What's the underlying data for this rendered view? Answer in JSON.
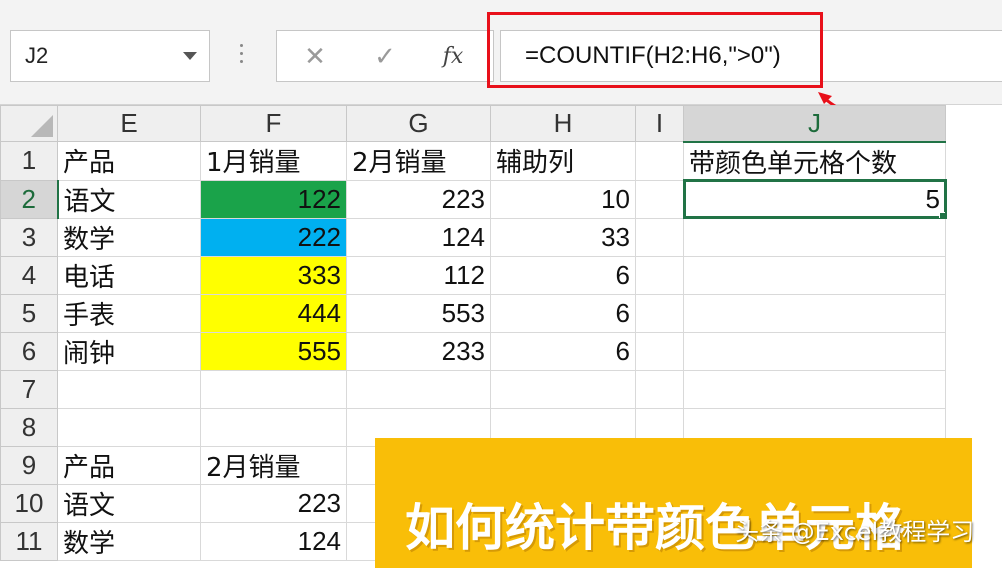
{
  "formula_bar": {
    "name_box": "J2",
    "cancel_icon": "✕",
    "enter_icon": "✓",
    "fx_label": "fx",
    "formula": "=COUNTIF(H2:H6,\">0\")"
  },
  "columns": [
    "E",
    "F",
    "G",
    "H",
    "I",
    "J"
  ],
  "selected_column": "J",
  "selected_row": "2",
  "rows": [
    {
      "num": "1",
      "E": "产品",
      "F": "1月销量",
      "G": "2月销量",
      "H": "辅助列",
      "I": "",
      "J": "带颜色单元格个数"
    },
    {
      "num": "2",
      "E": "语文",
      "F": "122",
      "G": "223",
      "H": "10",
      "I": "",
      "J": "5"
    },
    {
      "num": "3",
      "E": "数学",
      "F": "222",
      "G": "124",
      "H": "33",
      "I": "",
      "J": ""
    },
    {
      "num": "4",
      "E": "电话",
      "F": "333",
      "G": "112",
      "H": "6",
      "I": "",
      "J": ""
    },
    {
      "num": "5",
      "E": "手表",
      "F": "444",
      "G": "553",
      "H": "6",
      "I": "",
      "J": ""
    },
    {
      "num": "6",
      "E": "闹钟",
      "F": "555",
      "G": "233",
      "H": "6",
      "I": "",
      "J": ""
    },
    {
      "num": "7",
      "E": "",
      "F": "",
      "G": "",
      "H": "",
      "I": "",
      "J": ""
    },
    {
      "num": "8",
      "E": "",
      "F": "",
      "G": "",
      "H": "",
      "I": "",
      "J": ""
    },
    {
      "num": "9",
      "E": "产品",
      "F": "2月销量",
      "G": "",
      "H": "",
      "I": "",
      "J": ""
    },
    {
      "num": "10",
      "E": "语文",
      "F": "223",
      "G": "",
      "H": "",
      "I": "",
      "J": ""
    },
    {
      "num": "11",
      "E": "数学",
      "F": "124",
      "G": "",
      "H": "",
      "I": "",
      "J": ""
    }
  ],
  "fill_colors": {
    "F2": "#1aa34a",
    "F3": "#00b0f0",
    "F4": "#ffff00",
    "F5": "#ffff00",
    "F6": "#ffff00"
  },
  "colors": {
    "annotation_red": "#e8101a",
    "excel_green": "#217346",
    "banner_yellow": "#f9be08"
  },
  "banner": {
    "text": "如何统计带颜色单元格"
  },
  "watermark": "头条 @Excel教程学习"
}
